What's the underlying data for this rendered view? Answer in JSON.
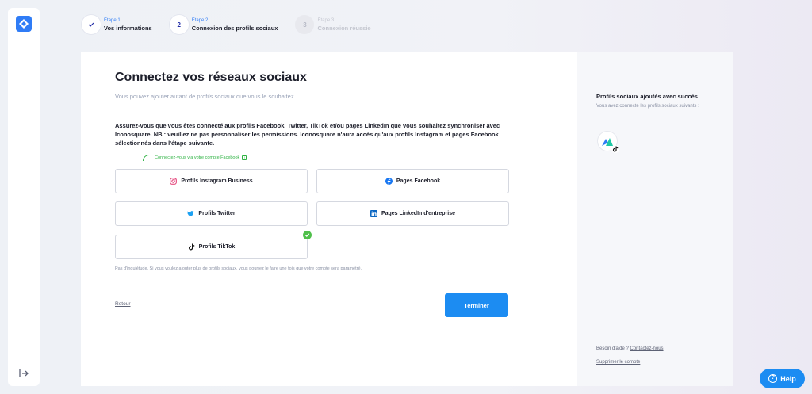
{
  "stepper": {
    "steps": [
      {
        "number": "",
        "kicker": "Étape 1",
        "title": "Vos informations",
        "state": "done"
      },
      {
        "number": "2",
        "kicker": "Étape 2",
        "title": "Connexion des profils sociaux",
        "state": "active"
      },
      {
        "number": "3",
        "kicker": "Étape 3",
        "title": "Connexion réussie",
        "state": "disabled"
      }
    ]
  },
  "main": {
    "title": "Connectez vos réseaux sociaux",
    "subtitle": "Vous pouvez ajouter autant de profils sociaux que vous le souhaitez.",
    "notice": "Assurez-vous que vous êtes connecté aux profils Facebook, Twitter, TikTok et/ou pages LinkedIn que vous souhaitez synchroniser avec Iconosquare. NB : veuillez ne pas personnaliser les permissions. Iconosquare n'aura accès qu'aux profils Instagram et pages Facebook sélectionnés dans l'étape suivante.",
    "connect_hint": "Connectez-vous via votre compte Facebook",
    "buttons": {
      "instagram": "Profils Instagram Business",
      "facebook": "Pages Facebook",
      "twitter": "Profils Twitter",
      "linkedin": "Pages LinkedIn d'entreprise",
      "tiktok": "Profils TikTok"
    },
    "reassure": "Pas d'inquiétude. Si vous voulez ajouter plus de profils sociaux, vous pourrez le faire une fois que votre compte sera paramétré.",
    "back_label": "Retour",
    "finish_label": "Terminer"
  },
  "side": {
    "title": "Profils sociaux ajoutés avec succès",
    "subtitle": "Vous avez connecté les profils sociaux suivants :",
    "help_text": "Besoin d'aide ?",
    "help_link": "Contactez-nous",
    "delete_account": "Supprimer le compte"
  },
  "help_fab": {
    "label": "Help"
  },
  "colors": {
    "accent": "#1c8cf2",
    "success": "#4fbf4a",
    "brand_navy": "#1f2aa6"
  }
}
